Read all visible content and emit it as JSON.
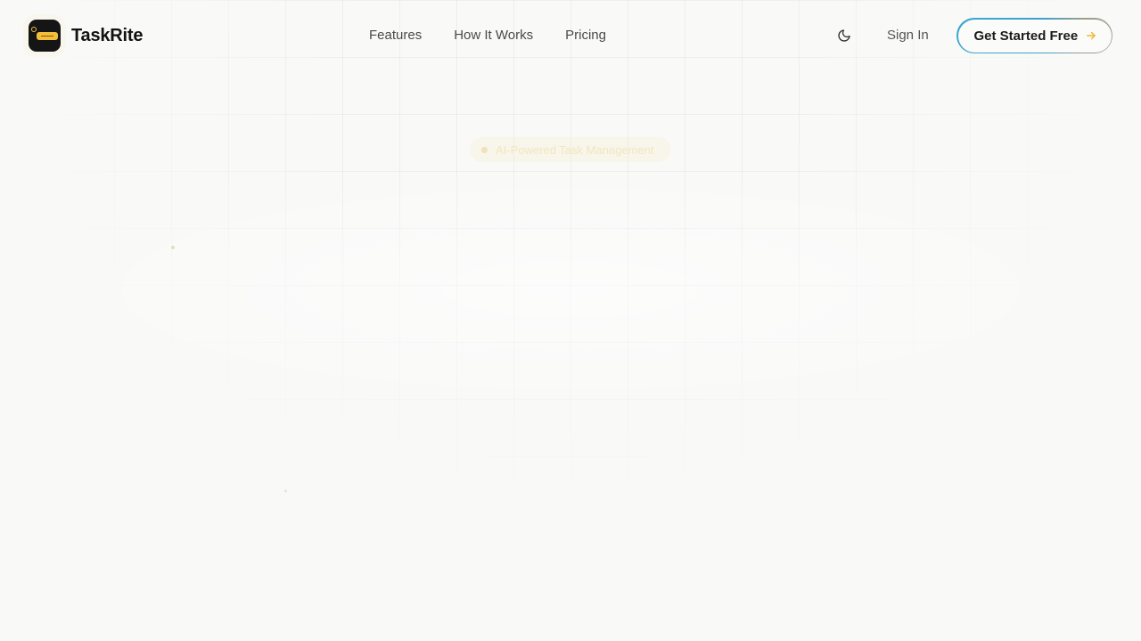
{
  "brand": {
    "name": "TaskRite"
  },
  "nav": {
    "items": [
      {
        "label": "Features"
      },
      {
        "label": "How It Works"
      },
      {
        "label": "Pricing"
      }
    ]
  },
  "header_actions": {
    "theme_toggle_icon": "moon-icon",
    "sign_in_label": "Sign In",
    "cta_label": "Get Started Free",
    "cta_icon": "arrow-right-icon"
  },
  "hero": {
    "badge_label": "AI-Powered Task Management"
  },
  "colors": {
    "accent": "#f3bd3c",
    "cta_border_start": "#3ba7cf",
    "cta_border_end": "#a2a38e",
    "background": "#f9f9f8"
  }
}
